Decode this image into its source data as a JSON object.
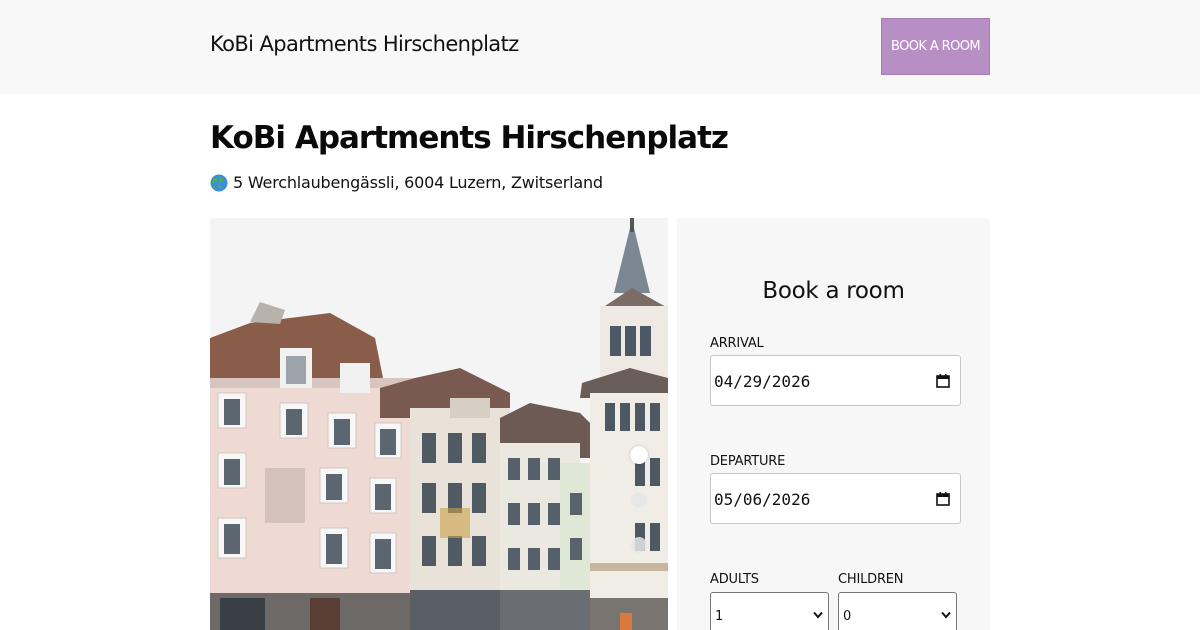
{
  "header": {
    "brand": "KoBi Apartments Hirschenplatz",
    "book_button": "BOOK A ROOM",
    "button_color": "#b78fc4"
  },
  "hotel": {
    "name": "KoBi Apartments Hirschenplatz",
    "address_icon": "globe-icon",
    "address": "5 Werchlaubengässli, 6004 Luzern, Zwitserland"
  },
  "gallery": {
    "slides_total": 3,
    "active_slide": 1
  },
  "booking": {
    "title": "Book a room",
    "arrival_label": "ARRIVAL",
    "arrival_value": "04/29/2026",
    "departure_label": "DEPARTURE",
    "departure_value": "05/06/2026",
    "adults_label": "ADULTS",
    "adults_value": "1",
    "children_label": "CHILDREN",
    "children_value": "0"
  }
}
